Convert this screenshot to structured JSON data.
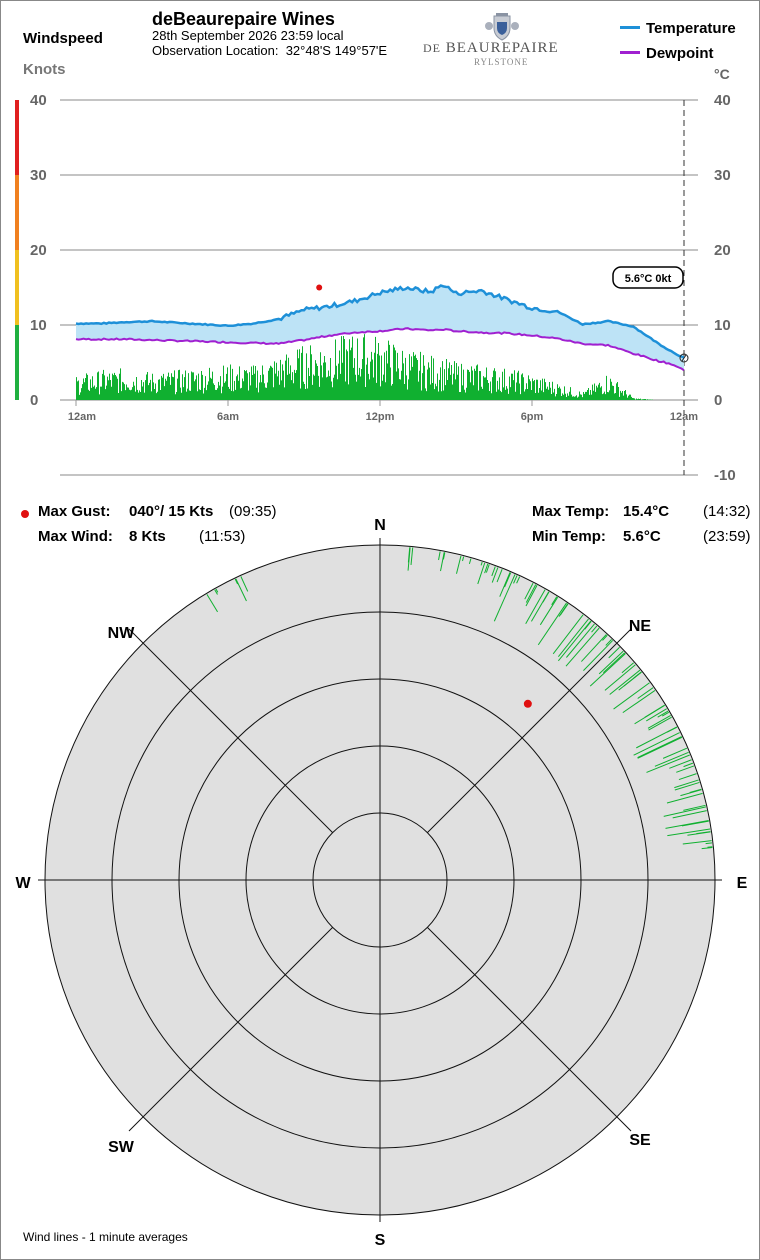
{
  "header": {
    "title": "deBeaurepaire Wines",
    "datetime": "28th September 2026  23:59 local",
    "location_label": "Observation Location:",
    "location_value": "32°48'S 149°57'E"
  },
  "logo": {
    "prefix": "DE",
    "name": "BEAUREPAIRE",
    "sub": "RYLSTONE"
  },
  "left_axis": {
    "title": "Windspeed",
    "unit": "Knots"
  },
  "right_axis": {
    "unit": "°C"
  },
  "legend": [
    {
      "label": "Temperature",
      "color": "#1e90d8"
    },
    {
      "label": "Dewpoint",
      "color": "#a020d0"
    }
  ],
  "current_readout": "5.6°C  0kt",
  "colors": {
    "wind_bars": "#10b030",
    "temp_fill": "#bde3f6",
    "temp_line": "#1e90d8",
    "dew_line": "#a020d0",
    "gust_dot": "#e01010",
    "polar_bg": "#e0e0e0",
    "scale_green": "#20b040",
    "scale_yellow": "#f0c020",
    "scale_orange": "#f08020",
    "scale_red": "#e02020"
  },
  "stats": {
    "gust_label": "Max Gust:",
    "gust_value": "040°/  15 Kts",
    "gust_time": "(09:35)",
    "wind_label": "Max Wind:",
    "wind_value": "8 Kts",
    "wind_time": "(11:53)",
    "maxtemp_label": "Max Temp:",
    "maxtemp_value": "15.4°C",
    "maxtemp_time": "(14:32)",
    "mintemp_label": "Min Temp:",
    "mintemp_value": "5.6°C",
    "mintemp_time": "(23:59)"
  },
  "compass": [
    "N",
    "NE",
    "E",
    "SE",
    "S",
    "SW",
    "W",
    "NW"
  ],
  "footer_note": "Wind lines - 1 minute averages",
  "chart_data": [
    {
      "type": "line",
      "x_labels": [
        "12am",
        "6am",
        "12pm",
        "6pm",
        "12am"
      ],
      "left_ylim": [
        0,
        40
      ],
      "left_ticks": [
        0,
        10,
        20,
        30,
        40
      ],
      "right_ylim": [
        -10,
        40
      ],
      "right_ticks": [
        -10,
        0,
        10,
        20,
        30,
        40
      ],
      "x_hours": [
        0,
        1,
        2,
        3,
        4,
        5,
        6,
        7,
        8,
        9,
        10,
        11,
        12,
        13,
        14,
        14.5,
        15,
        16,
        17,
        18,
        19,
        20,
        21,
        22,
        23,
        23.5,
        24
      ],
      "series": [
        {
          "name": "Temperature",
          "axis": "right",
          "values": [
            10.2,
            10.2,
            10.4,
            10.5,
            10.3,
            10.1,
            9.9,
            10.2,
            10.8,
            12.0,
            12.5,
            13.2,
            14.3,
            15.0,
            14.4,
            15.4,
            14.2,
            14.6,
            13.4,
            12.3,
            11.8,
            10.1,
            10.5,
            9.8,
            7.5,
            6.5,
            5.6
          ]
        },
        {
          "name": "Dewpoint",
          "axis": "right",
          "values": [
            8.1,
            8.1,
            8.1,
            8.0,
            7.9,
            7.8,
            7.7,
            7.6,
            7.5,
            8.0,
            8.6,
            9.0,
            9.2,
            9.5,
            9.3,
            9.4,
            9.2,
            9.0,
            8.9,
            8.6,
            8.2,
            7.5,
            7.3,
            6.2,
            5.2,
            4.8,
            4.0
          ]
        },
        {
          "name": "Windspeed",
          "axis": "left",
          "type": "bar",
          "values": [
            2.5,
            3.0,
            3.2,
            2.8,
            3.0,
            3.4,
            3.6,
            3.5,
            4.5,
            5.5,
            6.0,
            6.8,
            6.5,
            5.2,
            4.5,
            4.2,
            3.8,
            3.6,
            3.2,
            2.6,
            1.8,
            0.8,
            2.8,
            0.2,
            0.0,
            0.0,
            0.0
          ]
        }
      ],
      "gust_marker": {
        "hour": 9.6,
        "value": 15
      },
      "current_marker": {
        "hour": 24,
        "value": 5.6
      }
    },
    {
      "type": "polar",
      "directions": [
        "N",
        "NE",
        "E",
        "SE",
        "S",
        "SW",
        "W",
        "NW"
      ],
      "max_gust": {
        "direction_deg": 40,
        "speed_kts": 15
      },
      "wind_direction_range_deg": [
        0,
        85
      ],
      "wind_ticks_deg": [
        -30,
        -25,
        5,
        10,
        15,
        18,
        20,
        22,
        25,
        28,
        30,
        33,
        35,
        38,
        40,
        42,
        45,
        48,
        50,
        52,
        55,
        58,
        60,
        62,
        65,
        68,
        70,
        72,
        75,
        78,
        80,
        82,
        84
      ]
    }
  ]
}
